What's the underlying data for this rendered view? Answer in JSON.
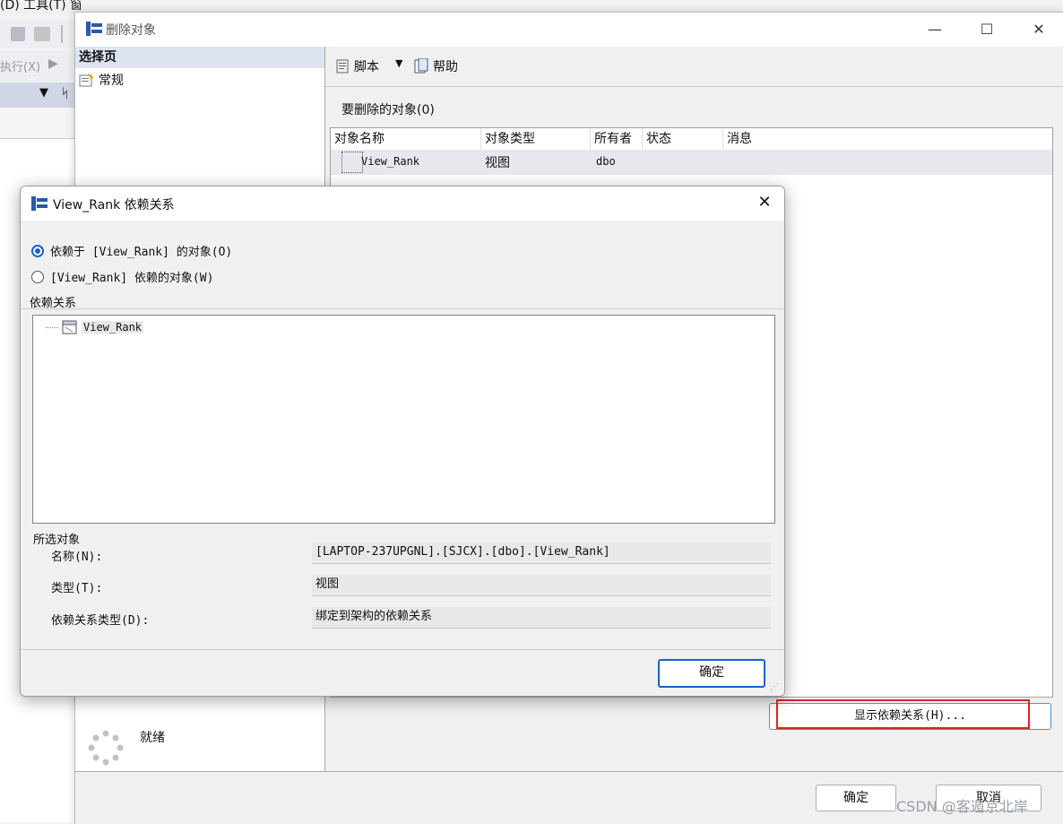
{
  "ssms": {
    "menu_text": "(D)   工具(T)   窗口(W)   社区(C)   帮助(H)",
    "exec_label": "执行(X)"
  },
  "delete_dialog": {
    "title": "删除对象",
    "select_page_header": "选择页",
    "page_general": "常规",
    "status_ready": "就绪",
    "toolbar": {
      "script_label": "脚本",
      "help_label": "帮助"
    },
    "objects_label": "要删除的对象(0)",
    "columns": [
      "对象名称",
      "对象类型",
      "所有者",
      "状态",
      "消息"
    ],
    "rows": [
      {
        "name": "View_Rank",
        "type": "视图",
        "owner": "dbo",
        "status": "",
        "message": ""
      }
    ],
    "show_dependencies_button": "显示依赖关系(H)...",
    "ok_button": "确定",
    "cancel_button": "取消"
  },
  "dependency_dialog": {
    "title": "View_Rank 依赖关系",
    "radio_options": [
      {
        "label": "依赖于 [View_Rank] 的对象(O)",
        "selected": true
      },
      {
        "label": "[View_Rank] 依赖的对象(W)",
        "selected": false
      }
    ],
    "dependencies_group": "依赖关系",
    "tree_items": [
      "View_Rank"
    ],
    "selected_object_group": "所选对象",
    "fields": [
      {
        "label": "名称(N):",
        "value": "[LAPTOP-237UPGNL].[SJCX].[dbo].[View_Rank]"
      },
      {
        "label": "类型(T):",
        "value": "视图"
      },
      {
        "label": "依赖关系类型(D):",
        "value": "绑定到架构的依赖关系"
      }
    ],
    "ok_button": "确定"
  },
  "watermark": "CSDN @客遁京北岸",
  "colors": {
    "accent": "#1464c8",
    "highlight_box": "#e52121",
    "header_bg": "#dde4f0"
  }
}
